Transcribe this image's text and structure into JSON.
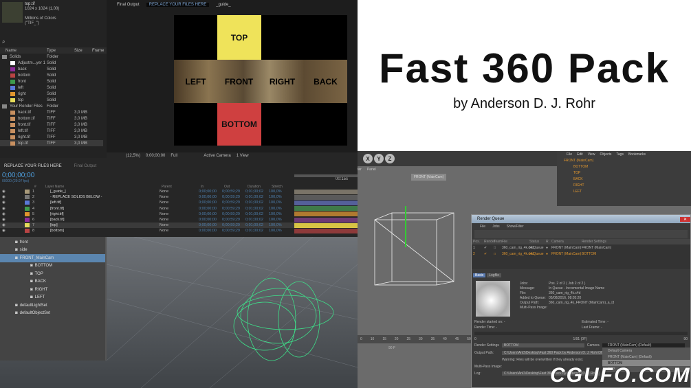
{
  "project": {
    "file": "top.tif",
    "dims": "1024 x 1024 (1,00)",
    "colors": "Millions of Colors",
    "format": "(\"TIF_\")",
    "columns": [
      "Name",
      "Type",
      "Size",
      "Frame"
    ],
    "items": [
      {
        "name": "Solids",
        "type": "Folder",
        "size": "",
        "color": "#d8c24a",
        "indent": 0
      },
      {
        "name": "Adjustm...yer 1",
        "type": "Solid",
        "size": "",
        "color": "#ffffff",
        "indent": 1
      },
      {
        "name": "back",
        "type": "Solid",
        "size": "",
        "color": "#8e2c9a",
        "indent": 1
      },
      {
        "name": "bottom",
        "type": "Solid",
        "size": "",
        "color": "#b94444",
        "indent": 1
      },
      {
        "name": "front",
        "type": "Solid",
        "size": "",
        "color": "#3e9a4c",
        "indent": 1
      },
      {
        "name": "left",
        "type": "Solid",
        "size": "",
        "color": "#5a78d8",
        "indent": 1
      },
      {
        "name": "right",
        "type": "Solid",
        "size": "",
        "color": "#e0962e",
        "indent": 1
      },
      {
        "name": "top",
        "type": "Solid",
        "size": "",
        "color": "#e6dc5a",
        "indent": 1
      },
      {
        "name": "Your Render Files",
        "type": "Folder",
        "size": "",
        "color": "#d8c24a",
        "indent": 0
      },
      {
        "name": "back.tif",
        "type": "TIFF",
        "size": "3,0 MB",
        "color": "#c89060",
        "indent": 1
      },
      {
        "name": "bottom.tif",
        "type": "TIFF",
        "size": "3,0 MB",
        "color": "#c89060",
        "indent": 1
      },
      {
        "name": "front.tif",
        "type": "TIFF",
        "size": "3,0 MB",
        "color": "#c89060",
        "indent": 1
      },
      {
        "name": "left.tif",
        "type": "TIFF",
        "size": "3,0 MB",
        "color": "#c89060",
        "indent": 1
      },
      {
        "name": "right.tif",
        "type": "TIFF",
        "size": "3,0 MB",
        "color": "#c89060",
        "indent": 1
      },
      {
        "name": "top.tif",
        "type": "TIFF",
        "size": "3,0 MB",
        "color": "#c89060",
        "indent": 1
      }
    ]
  },
  "comp": {
    "tabs": [
      "Final Output",
      "REPLACE YOUR FILES HERE",
      "_guide_"
    ],
    "faces": {
      "top": "TOP",
      "left": "LEFT",
      "front": "FRONT",
      "right": "RIGHT",
      "back": "BACK",
      "bottom": "BOTTOM"
    },
    "toolbar": {
      "zoom": "(12,5%)",
      "time": "0;00;00;00",
      "res": "Full",
      "camera": "Active Camera",
      "views": "1 View"
    }
  },
  "hero": {
    "title": "Fast 360 Pack",
    "byline": "by Anderson D. J. Rohr"
  },
  "timeline": {
    "tabs": [
      "REPLACE YOUR FILES HERE",
      "Final Output"
    ],
    "timecode": "0;00;00;00",
    "fps": "00000 (29.97 fps)",
    "ruler": "00:15s",
    "columns": [
      "#",
      "Layer Name",
      "Parent",
      "In",
      "Out",
      "Duration",
      "Stretch"
    ],
    "layers": [
      {
        "n": "1",
        "name": "[_guide_]",
        "color": "#a89a7a",
        "parent": "None",
        "in": "0;00;00;00",
        "out": "0;00;59;29",
        "dur": "0;01;00;02",
        "stretch": "100,0%",
        "bar": "#7a7468"
      },
      {
        "n": "2",
        "name": "- REPLACE SOLIDS BELOW -",
        "color": "#777777",
        "parent": "None",
        "in": "0;00;00;00",
        "out": "0;00;59;29",
        "dur": "0;01;00;02",
        "stretch": "100,0%",
        "bar": "#5a5a5a"
      },
      {
        "n": "3",
        "name": "[left.tif]",
        "color": "#5a78d8",
        "parent": "None",
        "in": "0;00;00;00",
        "out": "0;00;59;29",
        "dur": "0;01;00;02",
        "stretch": "100,0%",
        "bar": "#55609a"
      },
      {
        "n": "4",
        "name": "[front.tif]",
        "color": "#3e9a4c",
        "parent": "None",
        "in": "0;00;00;00",
        "out": "0;00;59;29",
        "dur": "0;01;00;02",
        "stretch": "100,0%",
        "bar": "#3f7a48"
      },
      {
        "n": "5",
        "name": "[right.tif]",
        "color": "#e0962e",
        "parent": "None",
        "in": "0;00;00;00",
        "out": "0;00;59;29",
        "dur": "0;01;00;02",
        "stretch": "100,0%",
        "bar": "#b07a30"
      },
      {
        "n": "6",
        "name": "[back.tif]",
        "color": "#8e2c9a",
        "parent": "None",
        "in": "0;00;00;00",
        "out": "0;00;59;29",
        "dur": "0;01;00;02",
        "stretch": "100,0%",
        "bar": "#6e3a74"
      },
      {
        "n": "7",
        "name": "[top]",
        "color": "#e6dc5a",
        "parent": "None",
        "in": "0;00;00;00",
        "out": "0;00;59;29",
        "dur": "0;01;00;02",
        "stretch": "100,0%",
        "bar": "#d8c444"
      },
      {
        "n": "8",
        "name": "[bottom]",
        "color": "#b94444",
        "parent": "None",
        "in": "0;00;00;00",
        "out": "0;00;59;29",
        "dur": "0;01;00;02",
        "stretch": "100,0%",
        "bar": "#8e3a3a"
      }
    ]
  },
  "maya": {
    "outliner": [
      {
        "name": "front",
        "indent": 1,
        "selected": false
      },
      {
        "name": "side",
        "indent": 1,
        "selected": false
      },
      {
        "name": "FRONT_MainCam",
        "indent": 1,
        "selected": true
      },
      {
        "name": "BOTTOM",
        "indent": 2,
        "selected": false
      },
      {
        "name": "TOP",
        "indent": 2,
        "selected": false
      },
      {
        "name": "BACK",
        "indent": 2,
        "selected": false
      },
      {
        "name": "RIGHT",
        "indent": 2,
        "selected": false
      },
      {
        "name": "LEFT",
        "indent": 2,
        "selected": false
      },
      {
        "name": "defaultLightSet",
        "indent": 1,
        "selected": false
      },
      {
        "name": "defaultObjectSet",
        "indent": 1,
        "selected": false
      }
    ]
  },
  "c4d": {
    "axes": [
      "X",
      "Y",
      "Z"
    ],
    "panel_menu": [
      "ter",
      "Panel"
    ],
    "camera_label": "FRONT (MainCam)",
    "om_menu": [
      "File",
      "Edit",
      "View",
      "Objects",
      "Tags",
      "Bookmarks"
    ],
    "objects": [
      "FRONT (MainCam)",
      "BOTTOM",
      "TOP",
      "BACK",
      "RIGHT",
      "LEFT"
    ],
    "ruler": [
      "0",
      "10",
      "15",
      "20",
      "25",
      "30",
      "35",
      "40",
      "45",
      "50",
      "55"
    ],
    "frame": "90 F"
  },
  "render_queue": {
    "title": "Render Queue",
    "menu": [
      "File",
      "Jobs",
      "Show/Filter"
    ],
    "columns": [
      "Pos.",
      "Render",
      "Team",
      "File",
      "Status",
      "R",
      "Camera",
      "Render Settings"
    ],
    "jobs": [
      {
        "pos": "1",
        "file": "360_cam_rig_4k.c4d",
        "status": "In Queue",
        "camera": "FRONT (MainCam)",
        "settings": "FRONT (MainCam)",
        "active": false
      },
      {
        "pos": "2",
        "file": "360_cam_rig_4k.c4d",
        "status": "In Queue",
        "camera": "FRONT (MainCam)",
        "settings": "BOTTOM",
        "active": true
      }
    ],
    "tabs": [
      "Basic",
      "Logfile"
    ],
    "info": [
      [
        "Jobs:",
        "Pos. 2 of 2 ( Job 2 of 2 )"
      ],
      [
        "Message:",
        "In Queue - Incremental Image Name"
      ],
      [
        "File:",
        "360_cam_rig_4k.c4d"
      ],
      [
        "Added to Queue:",
        "05/08/2016, 08:05:20"
      ],
      [
        "Output Path:",
        "360_cam_rig_4k_FRONT (MainCam)_a_i3"
      ],
      [
        "Multi-Pass Image:",
        ""
      ]
    ],
    "started_label": "Render started on:",
    "started": "-",
    "time_label": "Render Time:",
    "time": "-",
    "est_label": "Estimated Time:",
    "est": "-",
    "last_label": "Last Frame:",
    "last": "-",
    "progress_start": "0",
    "progress_mid": "1/91 (0F)",
    "progress_end": "90",
    "progress": 0,
    "settings_label": "Render Settings",
    "settings_value": "BOTTOM",
    "camera_label": "Camera",
    "camera_value": "FRONT (MainCam) (Default)",
    "output_label": "Output Path:",
    "output_value": "C:\\Users\\AnD\\Desktop\\Fast 360 Pack by Anderson D. J. Rohr\\360",
    "warning": "Warning: Files will be overwritten if they already exist.",
    "multipass_label": "Multi-Pass Image:",
    "log_label": "Log:",
    "log_value": "C:\\Users\\AnD\\Desktop\\Fast 360 Pack by Anderson D. J. Rohr",
    "camera_options": [
      "Default Camera",
      "FRONT (MainCam) (Default)",
      "BOTTOM",
      "TOP"
    ]
  },
  "watermark": "CGUFO.COM"
}
